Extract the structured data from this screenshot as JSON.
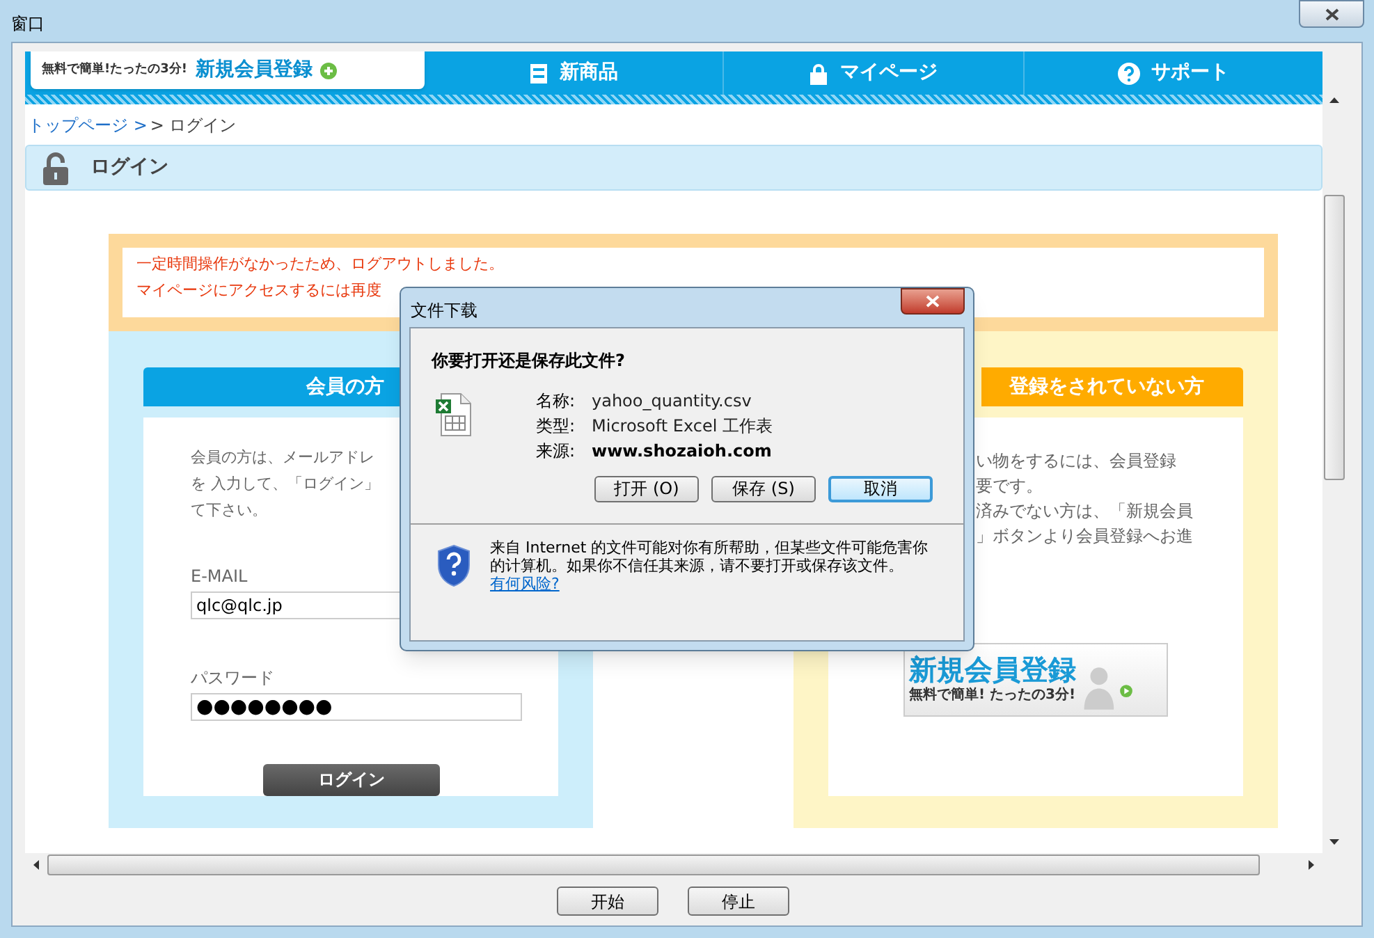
{
  "window": {
    "title": "窗口"
  },
  "nav": {
    "promo": {
      "caption": "無料で簡単!たったの3分!",
      "label": "新規会員登録"
    },
    "items": [
      {
        "label": "新商品",
        "kind": "box"
      },
      {
        "label": "マイページ",
        "kind": "lock"
      },
      {
        "label": "サポート",
        "kind": "help"
      }
    ]
  },
  "breadcrumb": [
    {
      "label": "トップページ >",
      "kind": "link"
    },
    {
      "label": "> ログイン",
      "kind": "current"
    }
  ],
  "page_heading": "ログイン",
  "notice": [
    "一定時間操作がなかったため、ログアウトしました。",
    "マイページにアクセスするには再度"
  ],
  "member": {
    "heading": "会員の方",
    "text_lines": [
      "会員の方は、メールアドレ",
      "を 入力して、「ログイン」",
      "て下さい。"
    ],
    "email": {
      "label": "E-MAIL",
      "value": "qlc@qlc.jp"
    },
    "password": {
      "label": "パスワード",
      "value": "●●●●●●●●"
    },
    "button": "ログイン"
  },
  "guest": {
    "heading": "登録をされていない方",
    "text_lines": [
      "い物をするには、会員登録",
      "要です。",
      "済みでない方は、「新規会員",
      "」ボタンより会員登録へお進"
    ],
    "banner": {
      "title": "新規会員登録",
      "caption": "無料で簡単! たったの3分!"
    }
  },
  "dialog": {
    "title": "文件下载",
    "question": "你要打开还是保存此文件?",
    "fields": [
      {
        "label": "名称:",
        "value": "yahoo_quantity.csv",
        "bold": false
      },
      {
        "label": "类型:",
        "value": "Microsoft Excel 工作表",
        "bold": false
      },
      {
        "label": "来源:",
        "value": "www.shozaioh.com",
        "bold": true
      }
    ],
    "buttons": [
      {
        "label": "打开 (O)",
        "default": false
      },
      {
        "label": "保存 (S)",
        "default": false
      },
      {
        "label": "取消",
        "default": true
      }
    ],
    "warning": "来自 Internet 的文件可能对你有所帮助，但某些文件可能危害你的计算机。如果你不信任其来源，请不要打开或保存该文件。",
    "link": "有何风险?"
  },
  "bottom_buttons": [
    "开始",
    "停止"
  ]
}
